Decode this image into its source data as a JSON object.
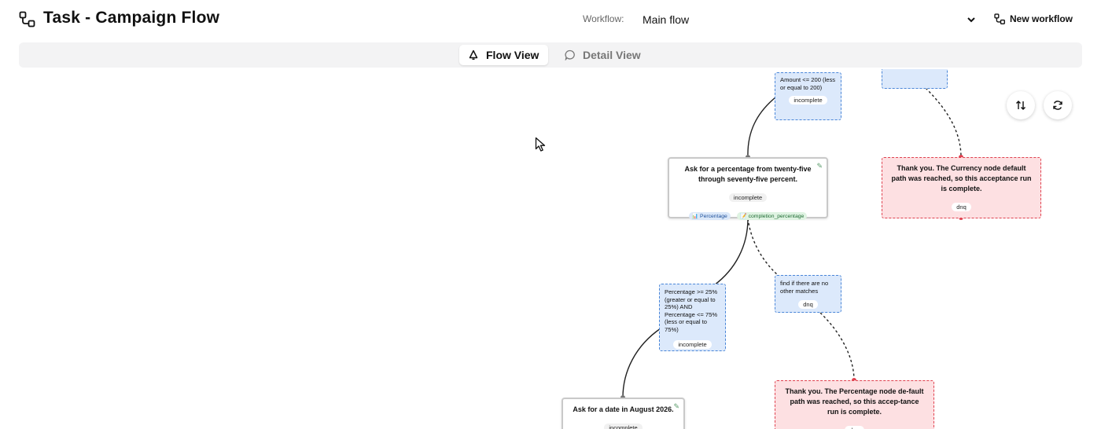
{
  "header": {
    "title": "Task - Campaign Flow",
    "workflow_label": "Workflow:",
    "workflow_value": "Main flow",
    "new_workflow_label": "New workflow"
  },
  "tabs": {
    "flow": "Flow View",
    "detail": "Detail View",
    "active": "Flow View"
  },
  "canvas": {
    "nodes": {
      "cond_amount": {
        "text": "Amount <= 200 (less or equal to 200)",
        "status": "incomplete"
      },
      "task_percentage": {
        "text": "Ask for a percentage from twenty-five through seventy-five percent.",
        "status": "incomplete",
        "tags": [
          "Percentage",
          "completion_percentage"
        ]
      },
      "end_currency": {
        "text": "Thank you. The Currency node default path was reached, so this acceptance run is complete.",
        "status": "dnq"
      },
      "cond_percentage": {
        "text": "Percentage >= 25% (greater or equal to 25%) AND Percentage <= 75% (less or equal to 75%)",
        "status": "incomplete"
      },
      "cond_nomatch": {
        "text": "find if there are no other matches",
        "status": "dnq"
      },
      "task_date": {
        "text": "Ask for a date in August 2026.",
        "status": "incomplete"
      },
      "end_percentage": {
        "text": "Thank you. The Percentage node de-fault path was reached, so this accep-tance run is complete.",
        "status": "dnq"
      }
    }
  },
  "icons": {
    "title": "workflow-icon",
    "new_workflow": "workflow-icon",
    "flow_tab": "bell-icon",
    "detail_tab": "chat-bubble-icon",
    "swap": "swap-vertical-icon",
    "refresh": "refresh-icon",
    "cursor": "mouse-cursor-icon"
  },
  "colors": {
    "condition_fill": "#dce9fb",
    "condition_border": "#4a86d8",
    "end_fill": "#fde0e2",
    "end_border": "#e0414f",
    "tab_bar": "#f3f3f4"
  }
}
